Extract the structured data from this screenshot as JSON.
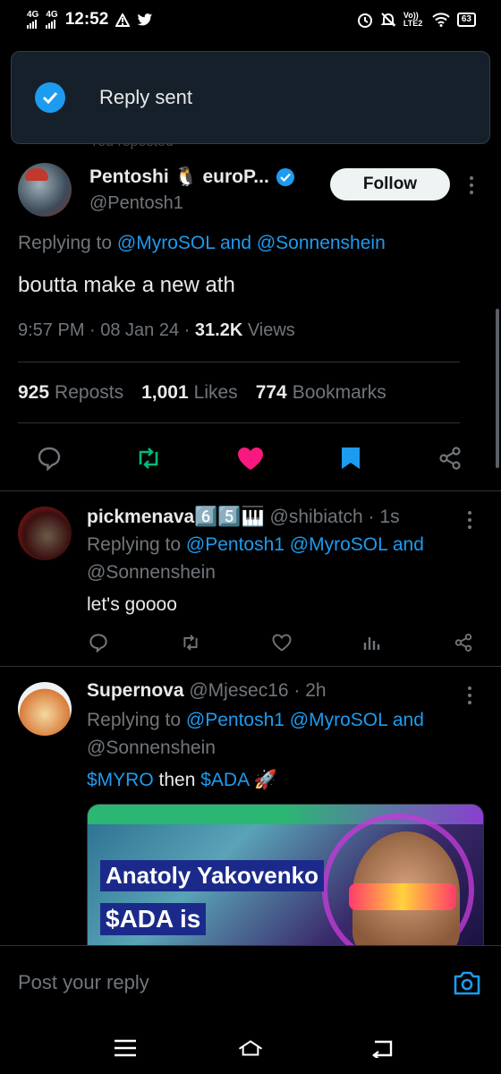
{
  "status_bar": {
    "net1": "4G",
    "net2": "4G",
    "time": "12:52",
    "volte": "Vo)) LTE2",
    "battery": "63"
  },
  "toast": {
    "text": "Reply sent"
  },
  "reposted_label": "You reposted",
  "tweet": {
    "author_name": "Pentoshi 🐧 euroP...",
    "author_handle": "@Pentosh1",
    "follow_label": "Follow",
    "replying_prefix": "Replying to ",
    "replying_targets": "@MyroSOL and @Sonnenshein",
    "text": "boutta make a new ath",
    "time": "9:57 PM · 08 Jan 24 · ",
    "views_count": "31.2K",
    "views_label": " Views",
    "reposts_count": "925",
    "reposts_label": "Reposts",
    "likes_count": "1,001",
    "likes_label": "Likes",
    "bookmarks_count": "774",
    "bookmarks_label": "Bookmarks"
  },
  "replies": [
    {
      "name": "pickmenava6️⃣5️⃣🎹",
      "handle_time": " @shibiatch · 1s",
      "replying_prefix": "Replying to ",
      "replying_line1": "@Pentosh1 @MyroSOL and",
      "replying_line2": "@Sonnenshein",
      "text": "let's goooo"
    },
    {
      "name": "Supernova",
      "handle_time": " @Mjesec16 · 2h",
      "replying_prefix": "Replying to ",
      "replying_line1": "@Pentosh1 @MyroSOL and",
      "replying_line2": "@Sonnenshein",
      "text_cashtag1": "$MYRO",
      "text_middle": " then ",
      "text_cashtag2": "$ADA",
      "text_emoji": " 🚀",
      "media_title": "Anatoly Yakovenko",
      "media_subtitle": "$ADA is"
    }
  ],
  "composer": {
    "placeholder": "Post your reply"
  },
  "colors": {
    "accent": "#1d9bf0",
    "repost_green": "#00ba7c",
    "like_pink": "#f91880",
    "text_secondary": "#71767b"
  },
  "icons": [
    "check-icon",
    "reply-icon",
    "repost-icon",
    "heart-icon",
    "bookmark-icon",
    "share-icon",
    "analytics-icon",
    "camera-icon",
    "more-icon",
    "verified-icon"
  ]
}
